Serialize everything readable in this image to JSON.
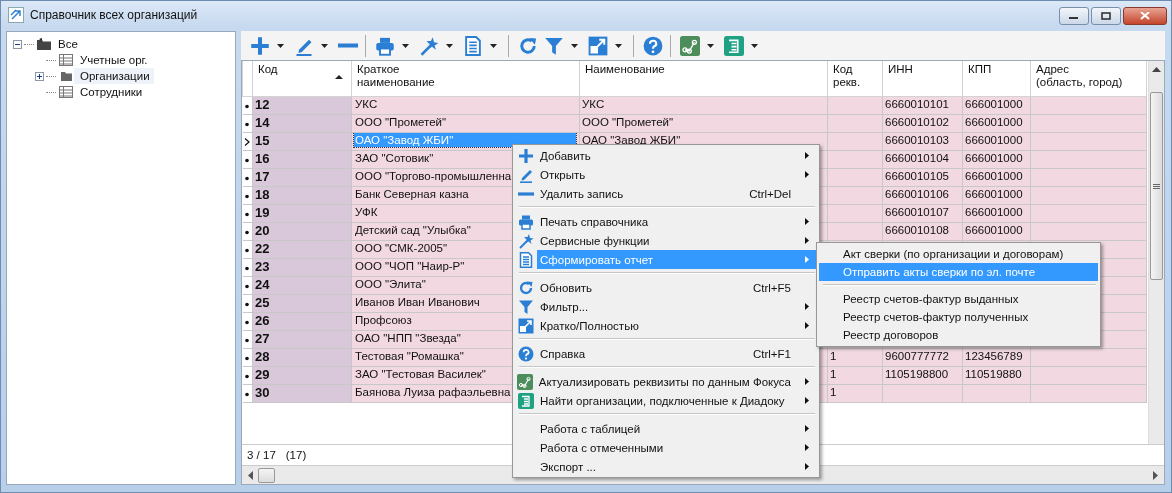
{
  "window": {
    "title": "Справочник всех организаций"
  },
  "tree": [
    {
      "label": "Все",
      "kind": "folder",
      "expanded": true,
      "selected": false,
      "children": [
        {
          "label": "Учетные орг.",
          "kind": "table",
          "selected": false
        },
        {
          "label": "Организации",
          "kind": "folder",
          "expanded": false,
          "selected": true
        },
        {
          "label": "Сотрудники",
          "kind": "table",
          "selected": false
        }
      ]
    }
  ],
  "toolbar": [
    {
      "kind": "add",
      "dropdown": true
    },
    {
      "kind": "edit",
      "dropdown": true
    },
    {
      "kind": "remove",
      "dropdown": false
    },
    {
      "kind": "separator"
    },
    {
      "kind": "print",
      "dropdown": true
    },
    {
      "kind": "wand",
      "dropdown": true
    },
    {
      "kind": "document",
      "dropdown": true
    },
    {
      "kind": "separator"
    },
    {
      "kind": "refresh",
      "dropdown": false
    },
    {
      "kind": "filter",
      "dropdown": true
    },
    {
      "kind": "expand",
      "dropdown": true
    },
    {
      "kind": "separator"
    },
    {
      "kind": "help",
      "dropdown": false
    },
    {
      "kind": "separator"
    },
    {
      "kind": "graph",
      "dropdown": true
    },
    {
      "kind": "list",
      "dropdown": true
    }
  ],
  "table": {
    "columns": [
      {
        "label": "Код",
        "sorted": true
      },
      {
        "label": "Краткое\nнаименование"
      },
      {
        "label": "Наименование"
      },
      {
        "label": "Код\nрекв."
      },
      {
        "label": "ИНН"
      },
      {
        "label": "КПП"
      },
      {
        "label": "Адрес\n(область, город)"
      }
    ],
    "rows": [
      {
        "current": false,
        "selected": false,
        "code": "12",
        "short": "УКС",
        "full": "УКС",
        "inn": "6660010101",
        "kpp": "666001000"
      },
      {
        "current": false,
        "selected": false,
        "code": "14",
        "short": "ООО \"Прометей\"",
        "full": "ООО \"Прометей\"",
        "inn": "6660010102",
        "kpp": "666001000"
      },
      {
        "current": true,
        "selected": true,
        "code": "15",
        "short": "ОАО \"Завод ЖБИ\"",
        "full": "ОАО \"Завод ЖБИ\"",
        "inn": "6660010103",
        "kpp": "666001000"
      },
      {
        "current": false,
        "selected": false,
        "code": "16",
        "short": "ЗАО \"Сотовик\"",
        "inn": "6660010104",
        "kpp": "666001000"
      },
      {
        "current": false,
        "selected": false,
        "code": "17",
        "short": "ООО \"Торгово-промышленна",
        "inn": "6660010105",
        "kpp": "666001000"
      },
      {
        "current": false,
        "selected": false,
        "code": "18",
        "short": "Банк Северная казна",
        "inn": "6660010106",
        "kpp": "666001000"
      },
      {
        "current": false,
        "selected": false,
        "code": "19",
        "short": "УФК",
        "inn": "6660010107",
        "kpp": "666001000"
      },
      {
        "current": false,
        "selected": false,
        "code": "20",
        "short": "Детский сад \"Улыбка\"",
        "inn": "6660010108",
        "kpp": "666001000"
      },
      {
        "current": false,
        "selected": false,
        "code": "22",
        "short": "ООО \"СМК-2005\""
      },
      {
        "current": false,
        "selected": false,
        "code": "23",
        "short": "ООО \"ЧОП \"Наир-Р\""
      },
      {
        "current": false,
        "selected": false,
        "code": "24",
        "short": "ООО \"Элита\""
      },
      {
        "current": false,
        "selected": false,
        "code": "25",
        "short": "Иванов Иван Иванович"
      },
      {
        "current": false,
        "selected": false,
        "code": "26",
        "short": "Профсоюз"
      },
      {
        "current": false,
        "selected": false,
        "code": "27",
        "short": "ОАО \"НПП \"Звезда\""
      },
      {
        "current": false,
        "selected": false,
        "code": "28",
        "short": "Тестовая \"Ромашка\"",
        "rekv": "1",
        "inn": "9600777772",
        "kpp": "123456789"
      },
      {
        "current": false,
        "selected": false,
        "code": "29",
        "short": "ЗАО \"Тестовая Василек\"",
        "rekv": "1",
        "inn": "1105198800",
        "kpp": "110519880"
      },
      {
        "current": false,
        "selected": false,
        "code": "30",
        "short": "Баянова Луиза рафаэльевна",
        "rekv": "1"
      }
    ]
  },
  "status": {
    "position": "3 / 17",
    "total": "(17)"
  },
  "context_menu": [
    {
      "kind": "add",
      "label": "Добавить",
      "submenu": true,
      "selected": false
    },
    {
      "kind": "edit",
      "label": "Открыть",
      "submenu": true,
      "selected": false
    },
    {
      "kind": "remove",
      "label": "Удалить запись",
      "shortcut": "Ctrl+Del",
      "submenu": false,
      "selected": false
    },
    {
      "kind": "separator"
    },
    {
      "kind": "print",
      "label": "Печать справочника",
      "submenu": true,
      "selected": false
    },
    {
      "kind": "wand",
      "label": "Сервисные функции",
      "submenu": true,
      "selected": false
    },
    {
      "kind": "document",
      "label": "Сформировать отчет",
      "submenu": true,
      "selected": true
    },
    {
      "kind": "separator"
    },
    {
      "kind": "refresh",
      "label": "Обновить",
      "shortcut": "Ctrl+F5",
      "submenu": false,
      "selected": false
    },
    {
      "kind": "filter",
      "label": "Фильтр...",
      "submenu": true,
      "selected": false
    },
    {
      "kind": "expand",
      "label": "Кратко/Полностью",
      "submenu": true,
      "selected": false
    },
    {
      "kind": "separator"
    },
    {
      "kind": "help",
      "label": "Справка",
      "shortcut": "Ctrl+F1",
      "submenu": false,
      "selected": false
    },
    {
      "kind": "separator"
    },
    {
      "kind": "graph",
      "label": "Актуализировать реквизиты по данным Фокуса",
      "submenu": true,
      "selected": false
    },
    {
      "kind": "list",
      "label": "Найти организации, подключенные к Диадоку",
      "submenu": true,
      "selected": false
    },
    {
      "kind": "separator"
    },
    {
      "kind": "plain",
      "label": "Работа с таблицей",
      "submenu": true,
      "selected": false
    },
    {
      "kind": "plain",
      "label": "Работа с отмеченными",
      "submenu": true,
      "selected": false
    },
    {
      "kind": "plain",
      "label": "Экспорт ...",
      "submenu": true,
      "selected": false
    }
  ],
  "submenu": [
    {
      "kind": "item",
      "label": "Акт сверки (по организации и договорам)",
      "selected": false
    },
    {
      "kind": "item",
      "label": "Отправить акты сверки по эл. почте",
      "selected": true
    },
    {
      "kind": "separator"
    },
    {
      "kind": "item",
      "label": "Реестр счетов-фактур выданных",
      "selected": false
    },
    {
      "kind": "item",
      "label": "Реестр счетов-фактур полученных",
      "selected": false
    },
    {
      "kind": "item",
      "label": "Реестр договоров",
      "selected": false
    }
  ]
}
